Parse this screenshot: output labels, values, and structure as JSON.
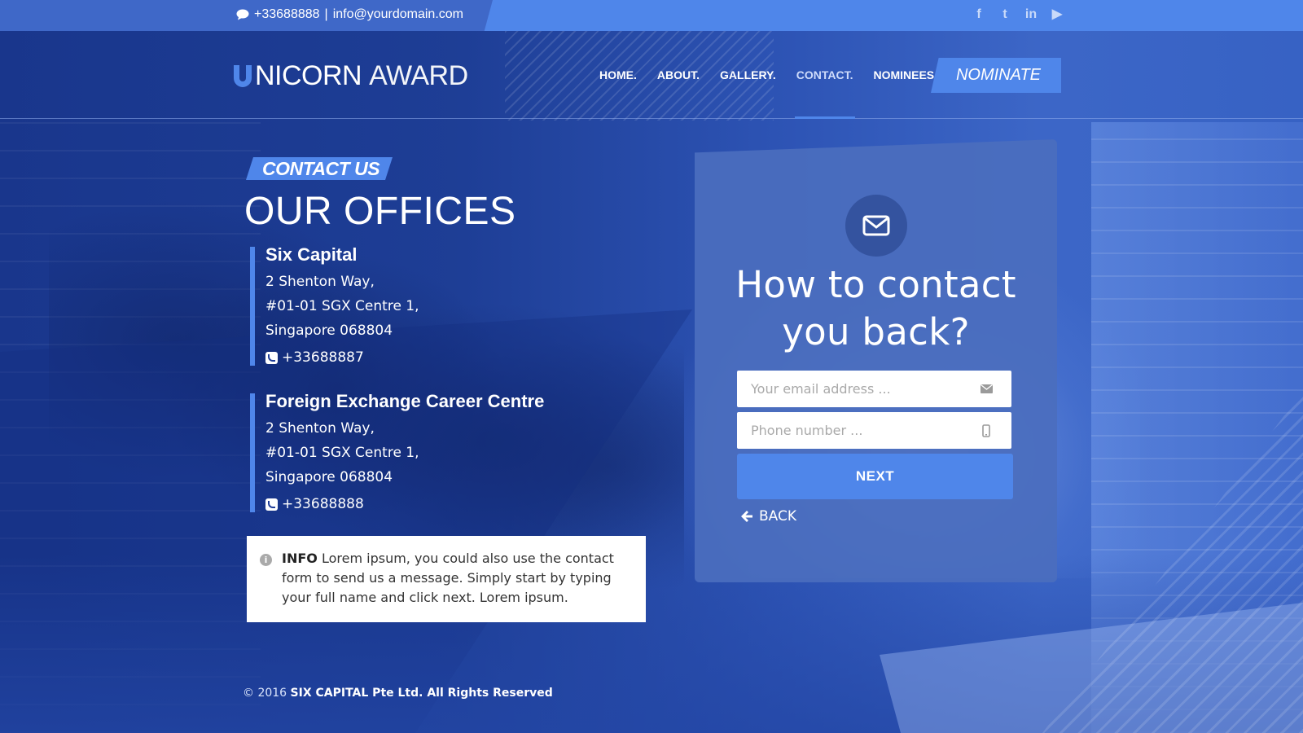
{
  "topbar": {
    "phone": "+33688888",
    "separator": "|",
    "email": "info@yourdomain.com",
    "social": [
      {
        "icon": "facebook-icon",
        "glyph": "f"
      },
      {
        "icon": "twitter-icon",
        "glyph": "t"
      },
      {
        "icon": "linkedin-icon",
        "glyph": "in"
      },
      {
        "icon": "youtube-icon",
        "glyph": "▶"
      }
    ]
  },
  "logo": {
    "mark": "U",
    "name_bold": "NICORN",
    "name_light": "AWARD"
  },
  "nav": {
    "items": [
      {
        "label": "HOME."
      },
      {
        "label": "ABOUT."
      },
      {
        "label": "GALLERY."
      },
      {
        "label": "CONTACT.",
        "active": true
      },
      {
        "label": "NOMINEES."
      }
    ],
    "cta_label": "NOMINATE"
  },
  "contact": {
    "tag": "CONTACT US",
    "title": "OUR OFFICES",
    "offices": [
      {
        "name": "Six Capital",
        "address": [
          "2 Shenton Way,",
          "#01-01 SGX Centre 1,",
          "Singapore 068804"
        ],
        "phone": "+33688887"
      },
      {
        "name": "Foreign Exchange Career Centre",
        "address": [
          "2 Shenton Way,",
          "#01-01 SGX Centre 1,",
          "Singapore 068804"
        ],
        "phone": "+33688888"
      }
    ],
    "info_label": "INFO",
    "info_text": "Lorem ipsum, you could also use the contact form to send us a message. Simply start by typing your full name and click next. Lorem ipsum."
  },
  "form": {
    "question_line1": "How to contact",
    "question_line2": "you back?",
    "email_placeholder": "Your email address ...",
    "email_value": "",
    "phone_placeholder": "Phone number ...",
    "phone_value": "",
    "next_label": "NEXT",
    "back_label": "BACK"
  },
  "footer": {
    "copyright": "© 2016",
    "company": "SIX CAPITAL Pte Ltd. All Rights Reserved"
  },
  "colors": {
    "accent": "#4f86ea",
    "topbar_dark": "#3f68c8",
    "background": "#1a3a8f",
    "card": "#4b6ebe"
  }
}
